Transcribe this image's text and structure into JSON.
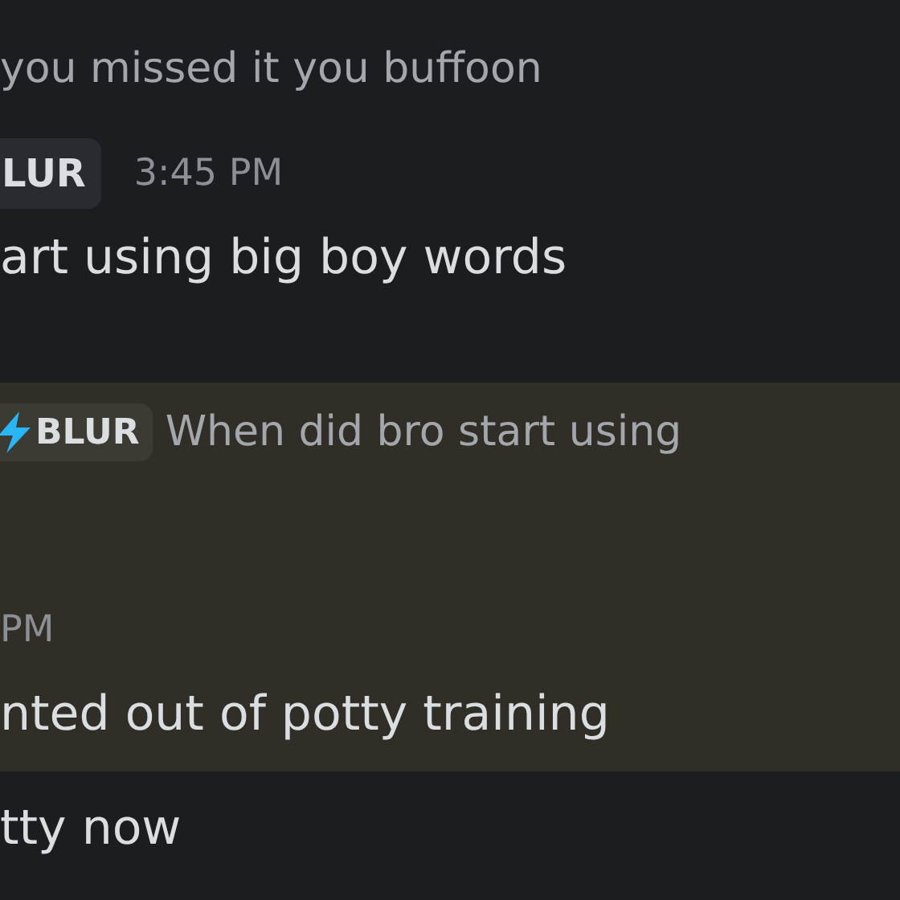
{
  "messages_above": [
    {
      "text": "you missed it you buffoon"
    }
  ],
  "message": {
    "tag": "LUR",
    "time": "3:45 PM",
    "text": "art using big boy words"
  },
  "highlighted_message": {
    "highlighted": true,
    "reply": {
      "tag": "BLUR",
      "text": "When did bro start using"
    },
    "time": "PM",
    "text": "nted out of potty training"
  },
  "message_below": {
    "text": "tty now"
  }
}
